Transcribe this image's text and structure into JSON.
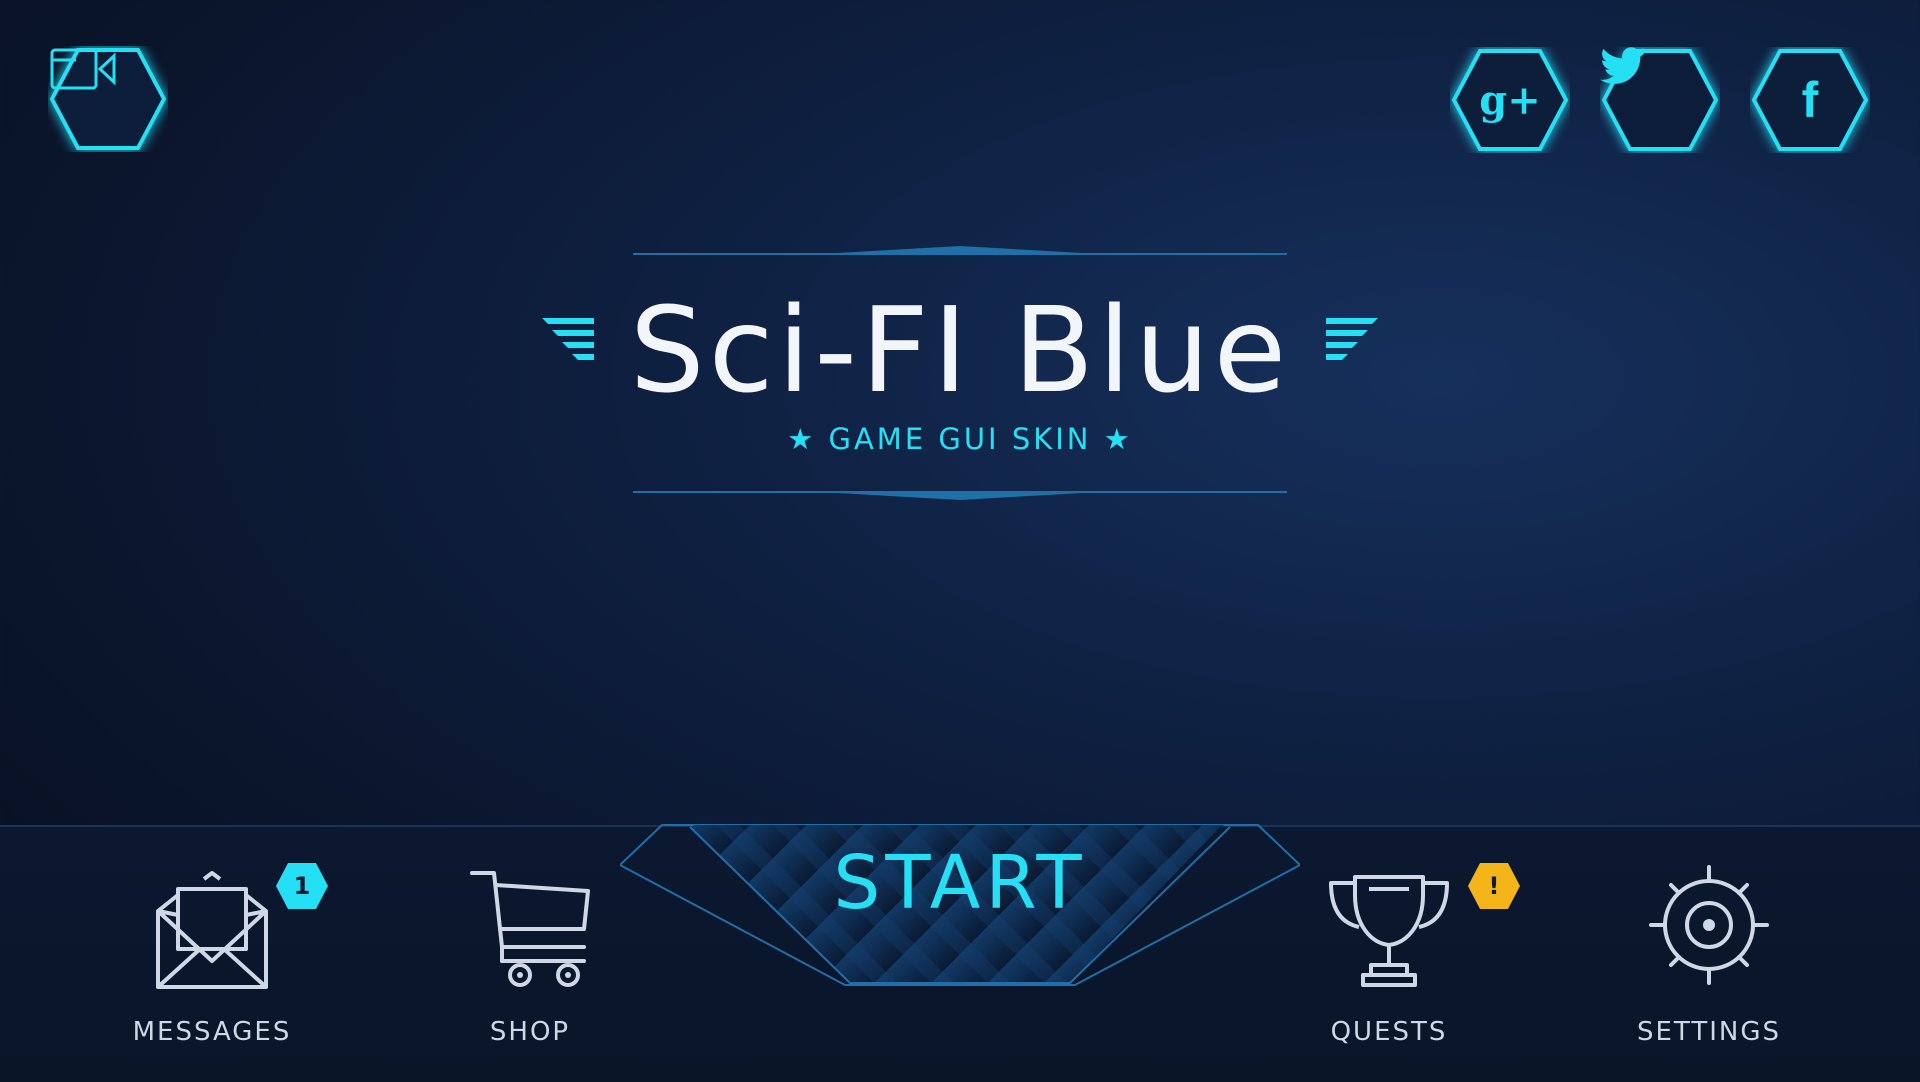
{
  "header": {
    "camera_icon": "video-camera-icon",
    "social": [
      {
        "name": "google-plus",
        "glyph": "g+"
      },
      {
        "name": "twitter",
        "glyph": "twitter-bird"
      },
      {
        "name": "facebook",
        "glyph": "f"
      }
    ]
  },
  "title": {
    "main": "Sci-FI Blue",
    "subtitle": "★ GAME GUI SKIN ★"
  },
  "start": {
    "label": "START"
  },
  "nav": {
    "messages": {
      "label": "MESSAGES",
      "badge": "1"
    },
    "shop": {
      "label": "SHOP"
    },
    "quests": {
      "label": "QUESTS",
      "badge": "!"
    },
    "settings": {
      "label": "SETTINGS"
    }
  },
  "colors": {
    "accent": "#25e0f5",
    "badge_alert": "#f4b41a",
    "text": "#cfd9e6"
  }
}
